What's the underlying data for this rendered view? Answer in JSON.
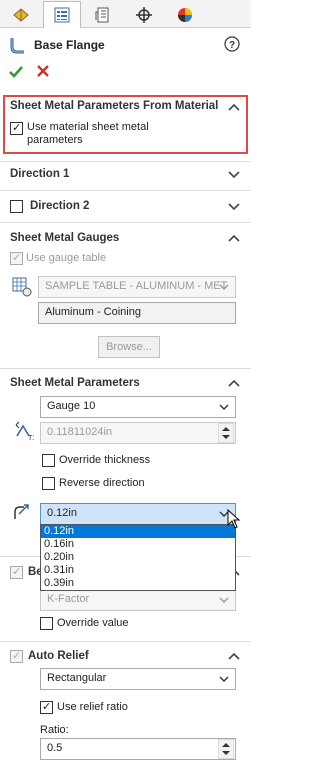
{
  "panel_title": "Base Flange",
  "smp_section": {
    "title": "Sheet Metal Parameters From Material",
    "checkbox_label_line1": "Use material sheet metal",
    "checkbox_label_line2": "parameters"
  },
  "direction1": {
    "title": "Direction 1"
  },
  "direction2": {
    "title": "Direction 2"
  },
  "gauges": {
    "title": "Sheet Metal Gauges",
    "use_gauge_table": "Use gauge table",
    "table_select": "SAMPLE TABLE - ALUMINUM - MET",
    "table_value": "Aluminum - Coining",
    "browse": "Browse..."
  },
  "params": {
    "title": "Sheet Metal Parameters",
    "gauge": "Gauge 10",
    "thickness": "0.11811024in",
    "override_thickness": "Override thickness",
    "reverse_direction": "Reverse direction",
    "radius_value": "0.12in",
    "radius_options": [
      "0.12in",
      "0.16in",
      "0.20in",
      "0.31in",
      "0.39in"
    ],
    "radius_selected_index": 0
  },
  "bend": {
    "title_partial": "Be",
    "kfactor": "K-Factor",
    "override_value": "Override value"
  },
  "auto_relief": {
    "title": "Auto Relief",
    "type": "Rectangular",
    "use_relief_ratio": "Use relief ratio",
    "ratio_label": "Ratio:",
    "ratio_value": "0.5"
  },
  "colors": {
    "accent_select": "#0078d7",
    "highlight_box": "#e04848",
    "ok_green": "#2f9a2f",
    "cancel_red": "#d22a2a"
  }
}
